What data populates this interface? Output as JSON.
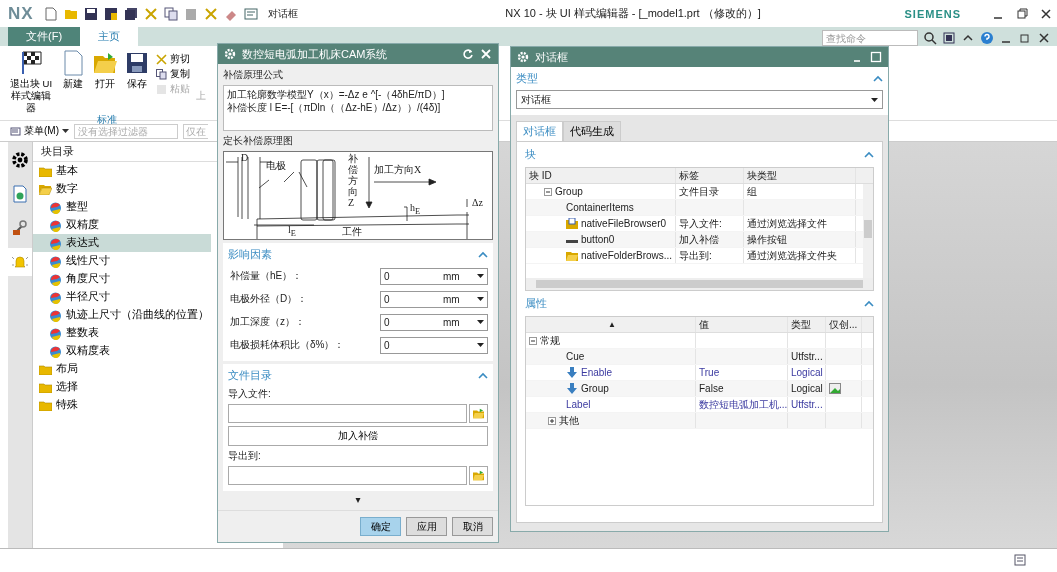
{
  "app": {
    "logo": "NX",
    "quick_dropdown": "对话框",
    "title": "NX 10 - 块 UI 样式编辑器 - [_model1.prt （修改的）]",
    "brand": "SIEMENS",
    "search": {
      "placeholder": "查找命令"
    }
  },
  "ribbon_tabs": [
    {
      "label": "文件(F)",
      "kind": "file",
      "selected": false
    },
    {
      "label": "主页",
      "kind": "page",
      "selected": true
    }
  ],
  "ribbon": {
    "big_buttons": [
      {
        "label": "退出块 UI 样式编辑器",
        "kind": "flag"
      },
      {
        "label": "新建",
        "kind": "new"
      },
      {
        "label": "打开",
        "kind": "open"
      },
      {
        "label": "保存",
        "kind": "save"
      }
    ],
    "small_buttons": [
      {
        "label": "剪切",
        "kind": "cut",
        "disabled": false
      },
      {
        "label": "复制",
        "kind": "copy",
        "disabled": false
      },
      {
        "label": "粘贴",
        "kind": "paste",
        "disabled": true
      }
    ],
    "partial_label": "上",
    "group": "标准"
  },
  "filter_bar": {
    "menu": "菜单(M)",
    "filter": {
      "placeholder": "没有选择过滤器"
    },
    "scope": "仅在"
  },
  "side_tabs": [
    {
      "kind": "gear",
      "selected": false
    },
    {
      "kind": "doc",
      "selected": false
    },
    {
      "kind": "tools",
      "selected": false
    },
    {
      "kind": "bell",
      "selected": true
    }
  ],
  "tree": {
    "title": "块目录",
    "items": [
      {
        "label": "基本",
        "kind": "folder",
        "expanded": false,
        "selected": false
      },
      {
        "label": "数字",
        "kind": "folder",
        "expanded": true,
        "selected": false,
        "children": [
          {
            "label": "整型",
            "kind": "block",
            "selected": false
          },
          {
            "label": "双精度",
            "kind": "block",
            "selected": false
          },
          {
            "label": "表达式",
            "kind": "block",
            "selected": true
          },
          {
            "label": "线性尺寸",
            "kind": "block",
            "selected": false
          },
          {
            "label": "角度尺寸",
            "kind": "block",
            "selected": false
          },
          {
            "label": "半径尺寸",
            "kind": "block",
            "selected": false
          },
          {
            "label": "轨迹上尺寸（沿曲线的位置）",
            "kind": "block",
            "selected": false
          },
          {
            "label": "整数表",
            "kind": "block",
            "selected": false
          },
          {
            "label": "双精度表",
            "kind": "block",
            "selected": false
          }
        ]
      },
      {
        "label": "布局",
        "kind": "folder",
        "expanded": false,
        "selected": false
      },
      {
        "label": "选择",
        "kind": "folder",
        "expanded": false,
        "selected": false
      },
      {
        "label": "特殊",
        "kind": "folder",
        "expanded": false,
        "selected": false
      }
    ]
  },
  "cam_dialog": {
    "title": "数控短电弧加工机床CAM系统",
    "formula_label": "补偿原理公式",
    "formula_lines": [
      "加工轮廓数学模型Y（x）=-Δz e ^[-（4δhE/πD）]",
      "补偿长度 l E=-[（πDln（（Δz-hE）/Δz））/(4δ)]"
    ],
    "diagram_label": "定长补偿原理图",
    "diagram_labels": [
      {
        "text": "D",
        "kind": "d"
      },
      {
        "text": "电极",
        "kind": "electrode"
      },
      {
        "text": "补偿方向Z",
        "kind": "zdir"
      },
      {
        "text": "加工方向X",
        "kind": "xdir"
      },
      {
        "text": "h$_{E}$",
        "kind": "he"
      },
      {
        "text": "Δz",
        "kind": "dz"
      },
      {
        "text": "l$_{E}$",
        "kind": "le"
      },
      {
        "text": "工件",
        "kind": "work"
      }
    ],
    "factors": {
      "title": "影响因素",
      "expanded": true,
      "fields": [
        {
          "label": "补偿量（hE）：",
          "value": "0",
          "unit": "mm"
        },
        {
          "label": "电极外径（D）：",
          "value": "0",
          "unit": "mm"
        },
        {
          "label": "加工深度（z）：",
          "value": "0",
          "unit": "mm"
        },
        {
          "label": "电极损耗体积比（δ%）：",
          "value": "0"
        }
      ]
    },
    "files": {
      "title": "文件目录",
      "expanded": true,
      "import_label": "导入文件:",
      "action": "加入补偿",
      "export_label": "导出到:"
    },
    "more": "▾",
    "buttons": [
      {
        "label": "确定",
        "primary": true
      },
      {
        "label": "应用",
        "primary": false
      },
      {
        "label": "取消",
        "primary": false
      }
    ]
  },
  "ui_dialog": {
    "title": "对话框",
    "type_section": {
      "title": "类型",
      "expanded": true,
      "value": "对话框"
    },
    "tabs": [
      {
        "label": "对话框",
        "selected": true
      },
      {
        "label": "代码生成",
        "selected": false
      }
    ],
    "blocks": {
      "title": "块",
      "expanded": true,
      "columns": [
        "块 ID",
        "标签",
        "块类型"
      ],
      "rows": [
        {
          "id": "Group",
          "label": "文件目录",
          "type": "组",
          "kind": "group",
          "expanded": true,
          "children": [
            {
              "id": "ContainerItems",
              "kind": "none"
            },
            {
              "id": "nativeFileBrowser0",
              "label": "导入文件:",
              "type": "通过浏览选择文件",
              "kind": "file"
            },
            {
              "id": "button0",
              "label": "加入补偿",
              "type": "操作按钮",
              "kind": "button"
            },
            {
              "id": "nativeFolderBrows...",
              "label": "导出到:",
              "type": "通过浏览选择文件夹",
              "kind": "folder"
            }
          ]
        }
      ]
    },
    "properties": {
      "title": "属性",
      "expanded": true,
      "columns": [
        "▲",
        "值",
        "类型",
        "仅创..."
      ],
      "rows": [
        {
          "name": "常规",
          "expanded": true,
          "children": [
            {
              "name": "Cue",
              "type": "Utfstr...",
              "modified": false,
              "arrow": false,
              "create_only": false
            },
            {
              "name": "Enable",
              "value": "True",
              "type": "Logical",
              "modified": true,
              "arrow": true,
              "create_only": false
            },
            {
              "name": "Group",
              "value": "False",
              "type": "Logical",
              "modified": false,
              "arrow": true,
              "create_only": true
            },
            {
              "name": "Label",
              "value": "数控短电弧加工机...",
              "type": "Utfstr...",
              "modified": true,
              "arrow": false,
              "create_only": false
            }
          ]
        },
        {
          "name": "其他",
          "expanded": false
        }
      ]
    }
  }
}
